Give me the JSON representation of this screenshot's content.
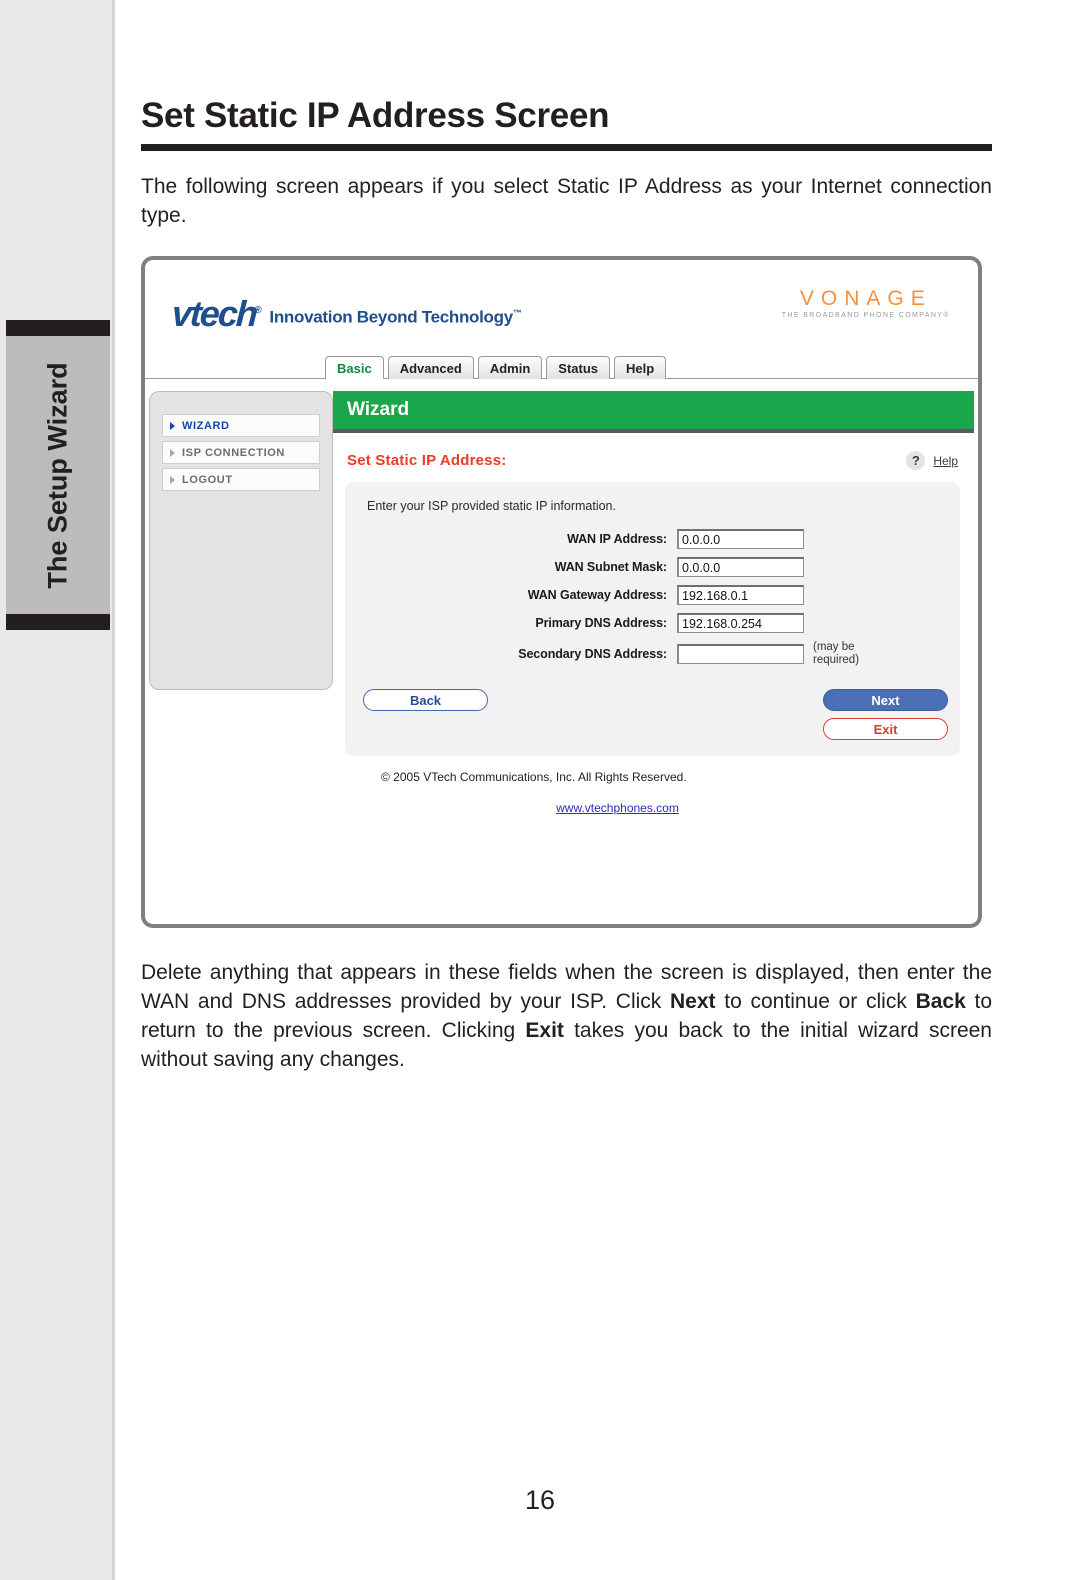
{
  "page": {
    "title": "Set Static IP Address Screen",
    "intro_paragraph": "The following screen appears if you select Static IP Address as your Internet connection type.",
    "page_number": "16",
    "thumb_tab_label": "The Setup Wizard"
  },
  "after_paragraph": {
    "part1": "Delete anything that appears in these fields when the screen is displayed, then enter the WAN and DNS addresses provided by your ISP. Click ",
    "bold1": "Next",
    "part2": " to continue or click ",
    "bold2": "Back",
    "part3": " to return to the previous screen. Clicking ",
    "bold3": "Exit",
    "part4": " takes you back to the initial wizard screen without saving any changes."
  },
  "screenshot": {
    "brand": {
      "vtech_word": "vtech",
      "vtech_registered": "®",
      "vtech_tagline": "Innovation Beyond Technology",
      "vtech_tm": "™",
      "vonage_word": "VONAGE",
      "vonage_tagline": "THE BROADBAND PHONE COMPANY®"
    },
    "tabs": [
      {
        "label": "Basic",
        "active": true
      },
      {
        "label": "Advanced",
        "active": false
      },
      {
        "label": "Admin",
        "active": false
      },
      {
        "label": "Status",
        "active": false
      },
      {
        "label": "Help",
        "active": false
      }
    ],
    "sidebar": [
      {
        "label": "WIZARD",
        "active": true
      },
      {
        "label": "ISP CONNECTION",
        "active": false
      },
      {
        "label": "LOGOUT",
        "active": false
      }
    ],
    "banner_title": "Wizard",
    "section_title": "Set Static IP Address:",
    "help_icon_glyph": "?",
    "help_label": "Help",
    "form_intro": "Enter your ISP provided static IP information.",
    "fields": [
      {
        "label": "WAN IP Address:",
        "value": "0.0.0.0",
        "note": ""
      },
      {
        "label": "WAN Subnet Mask:",
        "value": "0.0.0.0",
        "note": ""
      },
      {
        "label": "WAN Gateway Address:",
        "value": "192.168.0.1",
        "note": ""
      },
      {
        "label": "Primary DNS Address:",
        "value": "192.168.0.254",
        "note": ""
      },
      {
        "label": "Secondary DNS Address:",
        "value": "",
        "note": "(may be required)"
      }
    ],
    "buttons": {
      "back": "Back",
      "next": "Next",
      "exit": "Exit"
    },
    "copyright": "© 2005 VTech Communications, Inc. All Rights Reserved.",
    "website": "www.vtechphones.com"
  },
  "colors": {
    "green_banner": "#1aa64b",
    "section_red": "#ef3b24",
    "vonage_orange": "#f4913c",
    "vtech_blue": "#1f4e8c",
    "active_tab_green": "#0d8b3e",
    "sidebar_active_blue": "#1245a8",
    "next_button_blue": "#4a6fb5",
    "exit_button_red": "#d93b30"
  }
}
